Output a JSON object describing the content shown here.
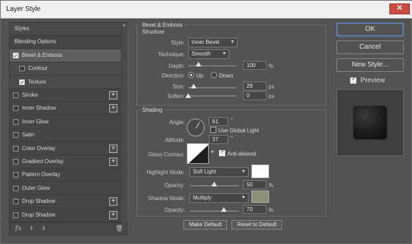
{
  "window": {
    "title": "Layer Style",
    "close_glyph": "✕"
  },
  "styles_panel": {
    "items": [
      {
        "label": "Styles",
        "checkbox": false,
        "checked": false,
        "plus": false
      },
      {
        "label": "Blending Options",
        "checkbox": false,
        "checked": false,
        "plus": false
      },
      {
        "label": "Bevel & Emboss",
        "checkbox": true,
        "checked": true,
        "plus": false,
        "selected": true
      },
      {
        "label": "Contour",
        "checkbox": true,
        "checked": false,
        "plus": false,
        "sub": true
      },
      {
        "label": "Texture",
        "checkbox": true,
        "checked": true,
        "plus": false,
        "sub": true
      },
      {
        "label": "Stroke",
        "checkbox": true,
        "checked": false,
        "plus": true
      },
      {
        "label": "Inner Shadow",
        "checkbox": true,
        "checked": false,
        "plus": true
      },
      {
        "label": "Inner Glow",
        "checkbox": true,
        "checked": false,
        "plus": false
      },
      {
        "label": "Satin",
        "checkbox": true,
        "checked": false,
        "plus": false
      },
      {
        "label": "Color Overlay",
        "checkbox": true,
        "checked": false,
        "plus": true
      },
      {
        "label": "Gradient Overlay",
        "checkbox": true,
        "checked": false,
        "plus": true
      },
      {
        "label": "Pattern Overlay",
        "checkbox": true,
        "checked": false,
        "plus": false
      },
      {
        "label": "Outer Glow",
        "checkbox": true,
        "checked": false,
        "plus": false
      },
      {
        "label": "Drop Shadow",
        "checkbox": true,
        "checked": false,
        "plus": true
      },
      {
        "label": "Drop Shadow",
        "checkbox": true,
        "checked": false,
        "plus": true
      }
    ],
    "tools": {
      "fx": "fx",
      "up": "⬆",
      "down": "⬇",
      "trash": "🗑"
    }
  },
  "bevel": {
    "heading": "Bevel & Emboss",
    "structure": {
      "title": "Structure",
      "style_label": "Style:",
      "style_value": "Inner Bevel",
      "technique_label": "Technique:",
      "technique_value": "Smooth",
      "depth_label": "Depth:",
      "depth_value": "100",
      "depth_unit": "%",
      "depth_pct": 1.0,
      "direction_label": "Direction:",
      "up_label": "Up",
      "down_label": "Down",
      "size_label": "Size:",
      "size_value": "29",
      "size_unit": "px",
      "size_pct": 0.12,
      "soften_label": "Soften:",
      "soften_value": "0",
      "soften_unit": "px",
      "soften_pct": 0.0
    },
    "shading": {
      "title": "Shading",
      "angle_label": "Angle:",
      "angle_value": "61",
      "angle_unit": "°",
      "global_light_label": "Use Global Light",
      "altitude_label": "Altitude:",
      "altitude_value": "37",
      "altitude_unit": "°",
      "gloss_label": "Gloss Contour:",
      "anti_aliased_label": "Anti-aliased",
      "highlight_mode_label": "Highlight Mode:",
      "highlight_mode_value": "Soft Light",
      "highlight_color": "#ffffff",
      "opacity1_label": "Opacity:",
      "opacity1_value": "50",
      "opacity1_unit": "%",
      "opacity1_pct": 0.5,
      "shadow_mode_label": "Shadow Mode:",
      "shadow_mode_value": "Multiply",
      "shadow_color": "#8b9076",
      "opacity2_label": "Opacity:",
      "opacity2_value": "70",
      "opacity2_unit": "%",
      "opacity2_pct": 0.7
    },
    "make_default": "Make Default",
    "reset_default": "Reset to Default"
  },
  "right": {
    "ok": "OK",
    "cancel": "Cancel",
    "new_style": "New Style...",
    "preview_label": "Preview"
  }
}
